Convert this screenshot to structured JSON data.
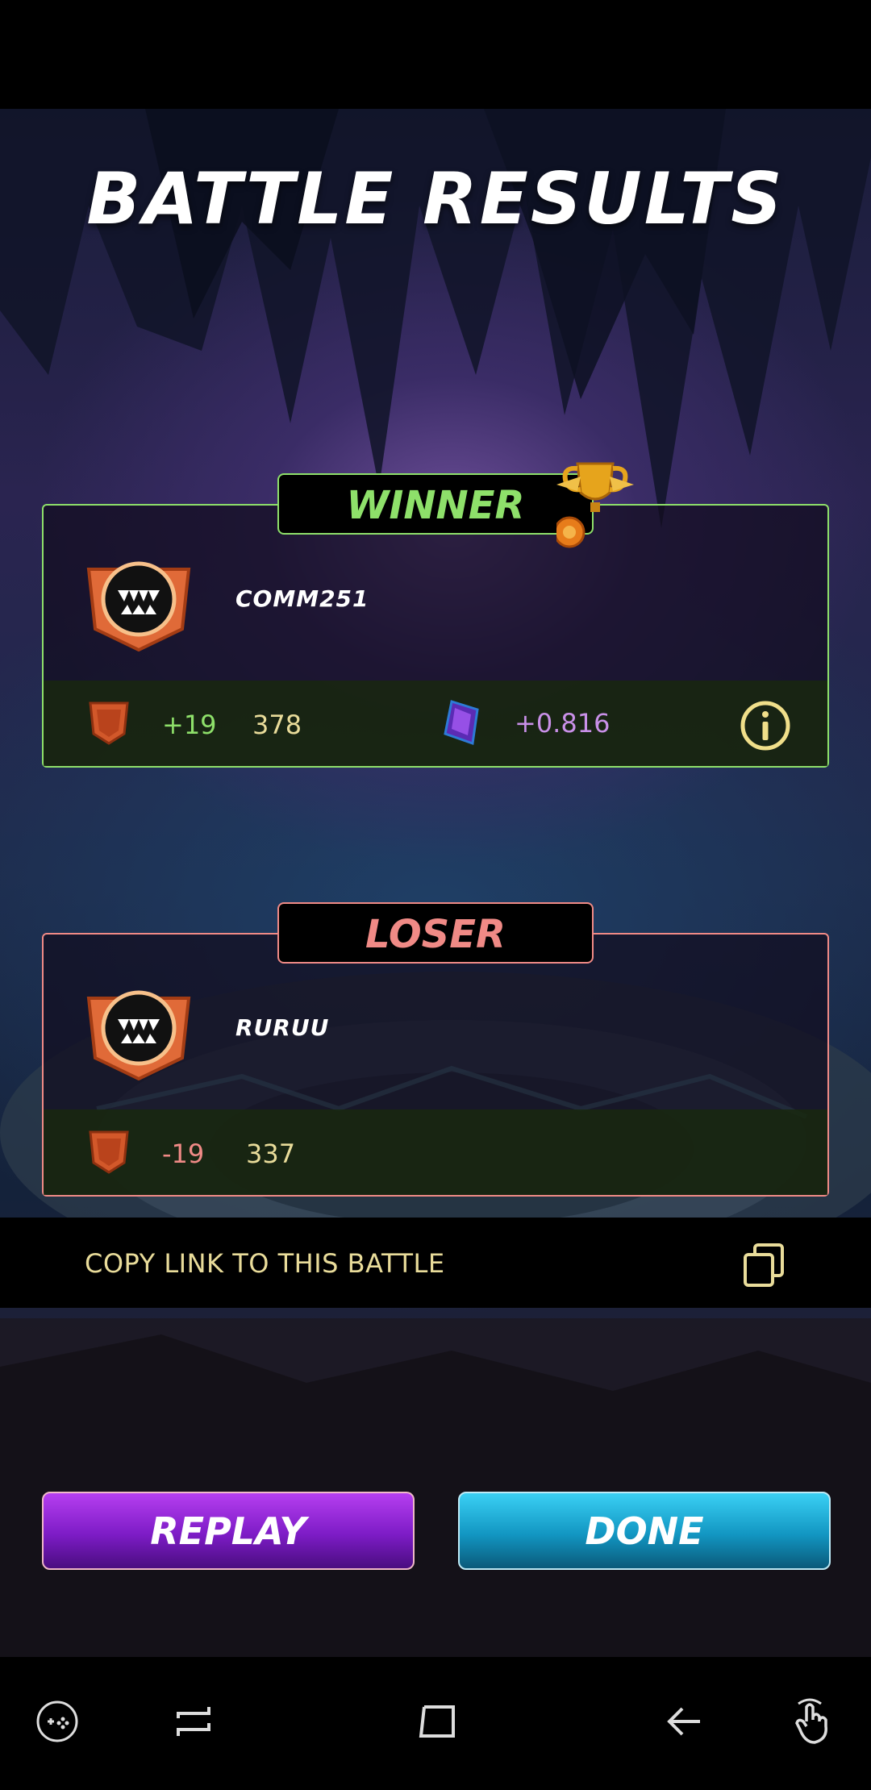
{
  "title": "BATTLE RESULTS",
  "winner": {
    "tag": "WINNER",
    "player": "COMM251",
    "rating_change": "+19",
    "rating": "378",
    "reward": "+0.816",
    "avatar_icon": "monster-fangs-badge-icon",
    "trophy_icon": "trophy-icon",
    "rating_icon": "shield-rating-icon",
    "reward_icon": "purple-crystal-icon",
    "info_icon": "info-icon"
  },
  "loser": {
    "tag": "LOSER",
    "player": "RURUU",
    "rating_change": "-19",
    "rating": "337",
    "avatar_icon": "monster-fangs-badge-icon",
    "rating_icon": "shield-rating-icon"
  },
  "copy_link": {
    "label": "COPY LINK TO THIS BATTLE",
    "icon": "copy-icon"
  },
  "buttons": {
    "replay": "REPLAY",
    "done": "DONE"
  },
  "colors": {
    "winner": "#8ee06a",
    "loser": "#f08a86",
    "gold_text": "#e9dc9a",
    "reward_text": "#c990e8",
    "replay_button": "#8a24d6",
    "done_button": "#1aa6d6"
  },
  "navbar": {
    "icons": [
      "game-tools-icon",
      "recent-apps-icon",
      "home-icon",
      "back-icon",
      "gesture-touch-icon"
    ]
  }
}
